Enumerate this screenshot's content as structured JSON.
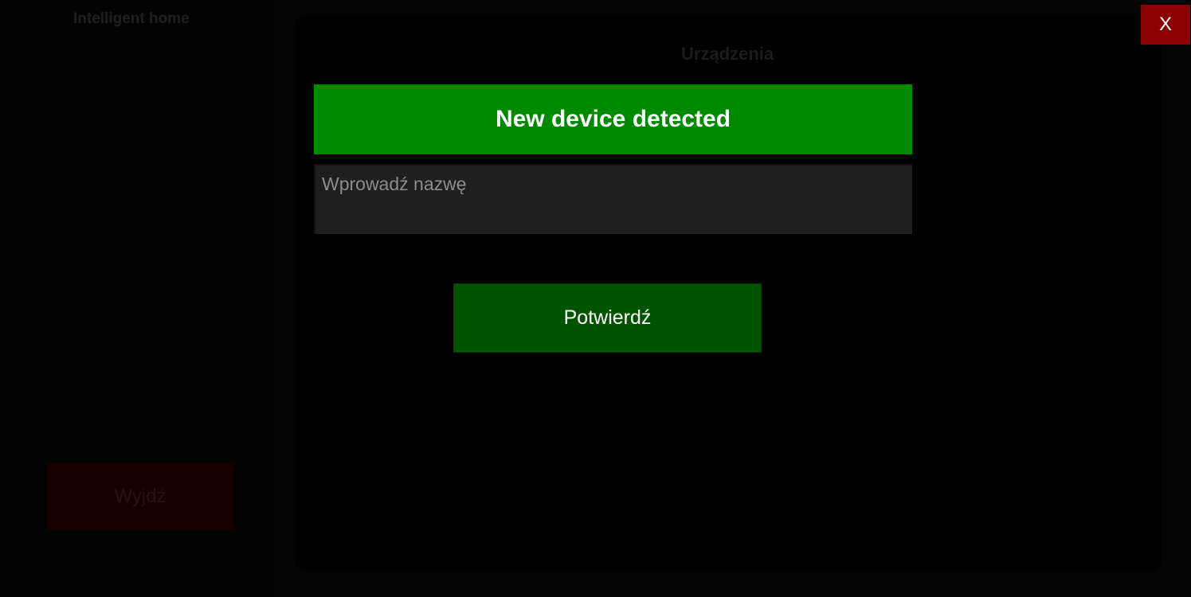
{
  "app": {
    "title": "Intelligent home"
  },
  "sidebar": {
    "exit_label": "Wyjdź"
  },
  "panel": {
    "title": "Urządzenia"
  },
  "dialog": {
    "title": "New device detected",
    "name_input": {
      "value": "",
      "placeholder": "Wprowadź nazwę"
    },
    "confirm_label": "Potwierdź"
  },
  "window": {
    "close_label": "X"
  },
  "colors": {
    "header_green": "#008a00",
    "confirm_green": "#005400",
    "close_red": "#8b0000",
    "input_bg": "#1f1f1f"
  }
}
